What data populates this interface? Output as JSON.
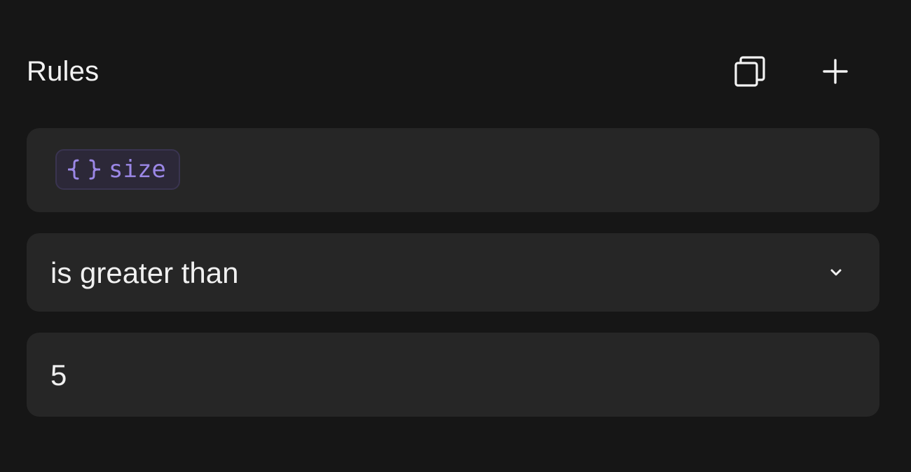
{
  "header": {
    "title": "Rules",
    "copy_icon": "copy-icon",
    "add_icon": "plus-icon"
  },
  "rule": {
    "variable": {
      "icon": "braces-icon",
      "name": "size"
    },
    "operator": {
      "selected": "is greater than",
      "icon": "chevron-down-icon"
    },
    "value": "5"
  },
  "colors": {
    "background": "#161616",
    "field": "#262626",
    "chip_bg": "#2c2838",
    "chip_text": "#9b87e6",
    "text": "#f0f0f0"
  }
}
